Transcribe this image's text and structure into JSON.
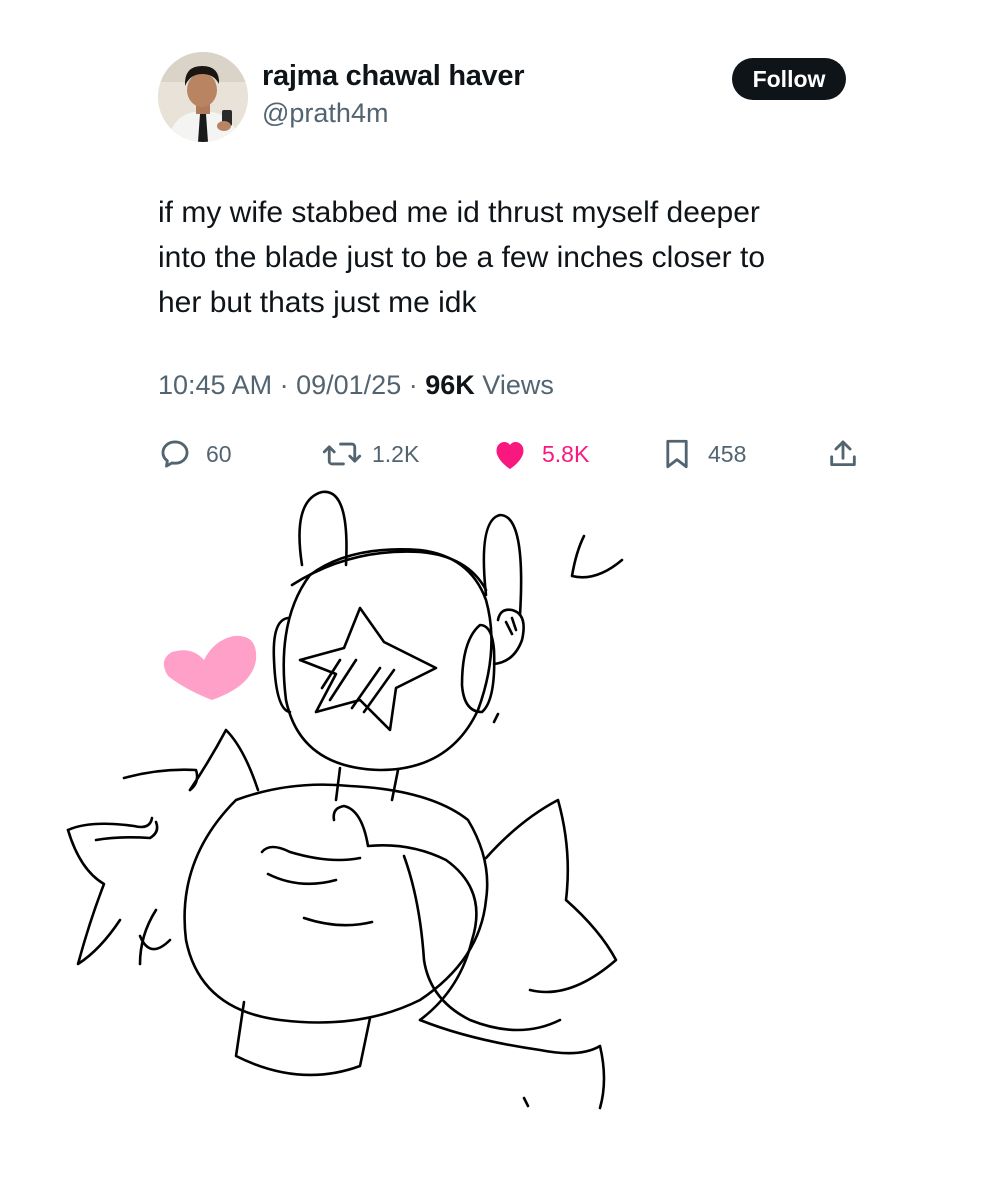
{
  "tweet": {
    "author": {
      "display_name": "rajma chawal haver",
      "handle": "@prath4m"
    },
    "follow_label": "Follow",
    "text_lines": [
      "if my wife stabbed me id thrust myself deeper",
      "into the blade just to be a few inches closer to",
      "her but thats just me idk"
    ],
    "time": "10:45 AM",
    "date": "09/01/25",
    "views_count": "96K",
    "views_label": "Views",
    "separator": "·",
    "actions": {
      "replies": "60",
      "reposts": "1.2K",
      "likes": "5.8K",
      "bookmarks": "458"
    },
    "icons": [
      "reply-icon",
      "repost-icon",
      "heart-icon",
      "bookmark-icon",
      "share-icon"
    ],
    "colors": {
      "like_pink": "#f91880",
      "muted_gray": "#536471",
      "text_black": "#0f1419",
      "heart_doodle_pink": "#ffa0c8"
    }
  }
}
